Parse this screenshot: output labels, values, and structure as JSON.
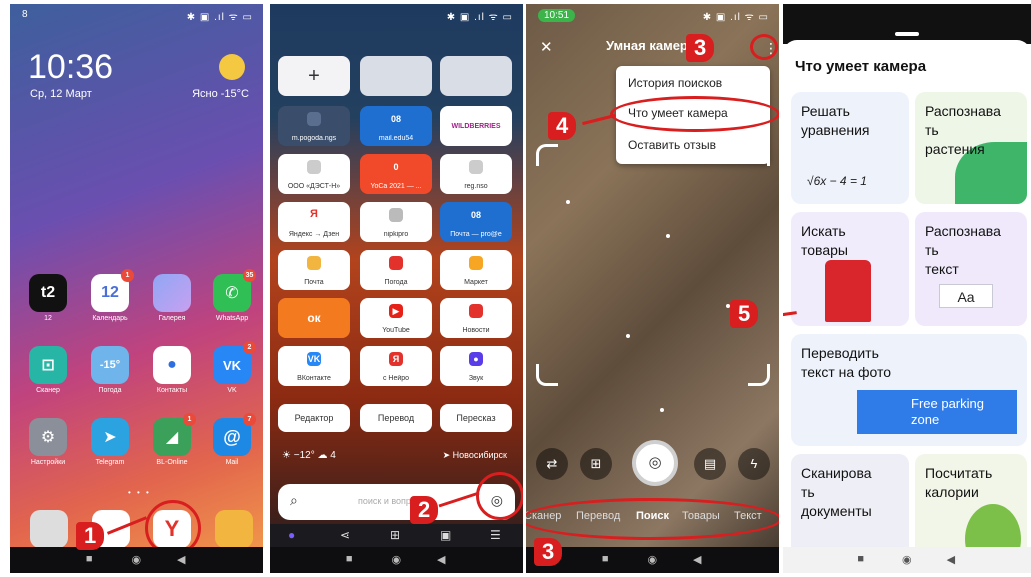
{
  "panel1": {
    "status_left": "8",
    "status_right": "✱ ▣ .ıl ᯤ ▭",
    "clock": "10:36",
    "date": "Ср, 12 Март",
    "weather": "Ясно -15°С",
    "apps": [
      {
        "label": "12",
        "glyph": "t2",
        "badge": ""
      },
      {
        "label": "Календарь",
        "glyph": "12",
        "badge": "1"
      },
      {
        "label": "Галерея",
        "glyph": "",
        "badge": ""
      },
      {
        "label": "WhatsApp",
        "glyph": "✆",
        "badge": "35"
      },
      {
        "label": "Сканер",
        "glyph": "⊡",
        "badge": ""
      },
      {
        "label": "Погода",
        "glyph": "-15°",
        "badge": ""
      },
      {
        "label": "Контакты",
        "glyph": "●",
        "badge": ""
      },
      {
        "label": "VK",
        "glyph": "VK",
        "badge": "2"
      },
      {
        "label": "Настройки",
        "glyph": "⚙",
        "badge": ""
      },
      {
        "label": "Telegram",
        "glyph": "➤",
        "badge": ""
      },
      {
        "label": "BL-Online",
        "glyph": "◢",
        "badge": "1"
      },
      {
        "label": "Mail",
        "glyph": "@",
        "badge": "7"
      }
    ],
    "page_dots": "• • •",
    "yandex_glyph": "Y",
    "annot_num": "1"
  },
  "panel2": {
    "status_right": "✱ ▣ .ıl ᯤ ▭",
    "add_tile": "+",
    "tiles": [
      {
        "label": "m.pogoda.ngs",
        "glyph": ""
      },
      {
        "label": "mail.edu54",
        "glyph": "08"
      },
      {
        "label": "WILDBERRIES",
        "glyph": ""
      },
      {
        "label": "ООО «ДЭСТ-Н»",
        "glyph": ""
      },
      {
        "label": "YoCa 2021 — ...",
        "glyph": "0"
      },
      {
        "label": "reg.nso",
        "glyph": ""
      },
      {
        "label": "Яндекс → Дзен",
        "glyph": "Я"
      },
      {
        "label": "nipkipro",
        "glyph": ""
      },
      {
        "label": "Почта — pro@e",
        "glyph": "08"
      },
      {
        "label": "Почта",
        "glyph": ""
      },
      {
        "label": "Погода",
        "glyph": ""
      },
      {
        "label": "Маркет",
        "glyph": ""
      },
      {
        "label": "ОК",
        "glyph": "ок"
      },
      {
        "label": "YouTube",
        "glyph": "▶"
      },
      {
        "label": "Новости",
        "glyph": ""
      },
      {
        "label": "ВКонтакте",
        "glyph": "VK"
      },
      {
        "label": "с Нейро",
        "glyph": "Я"
      },
      {
        "label": "Звук",
        "glyph": "●"
      }
    ],
    "services": [
      "Редактор",
      "Перевод",
      "Пересказ"
    ],
    "weather": "☀ −12°  ☁ 4",
    "city": "➤ Новосибирск",
    "search_placeholder": "поиск и вопросы",
    "search_icon": "⌕",
    "camera_icon": "◎",
    "bottom": [
      "●",
      "⋖",
      "⊞",
      "▣",
      "☰"
    ],
    "annot_num": "2"
  },
  "panel3": {
    "status_left": "10:51",
    "status_right": "✱ ▣ .ıl ᯤ ▭",
    "close": "✕",
    "title": "Умная камера",
    "kebab": "⋮",
    "menu": [
      "История поисков",
      "Что умеет камера",
      "Оставить отзыв"
    ],
    "controls": [
      "⇄",
      "⊞",
      "▤",
      "ϟ"
    ],
    "shutter": "◎",
    "modes": [
      "Сканер",
      "Перевод",
      "Поиск",
      "Товары",
      "Текст"
    ],
    "annot_top": "3",
    "annot_menu": "4",
    "annot_bottom": "3"
  },
  "panel4": {
    "title": "Что умеет камера",
    "cards": [
      {
        "text": "Решать\nуравнения",
        "extra": "√6x − 4 = 1"
      },
      {
        "text": "Распознава\nть\nрастения",
        "extra": ""
      },
      {
        "text": "Искать\nтовары",
        "extra": ""
      },
      {
        "text": "Распознава\nть\nтекст",
        "extra": "Aa"
      },
      {
        "text": "Переводить\nтекст на фото",
        "extra": "Free parking\nzone"
      },
      {
        "text": "Сканирова\nть\nдокументы",
        "extra": ""
      },
      {
        "text": "Посчитать\nкалории",
        "extra": ""
      }
    ],
    "annot_num": "5"
  }
}
